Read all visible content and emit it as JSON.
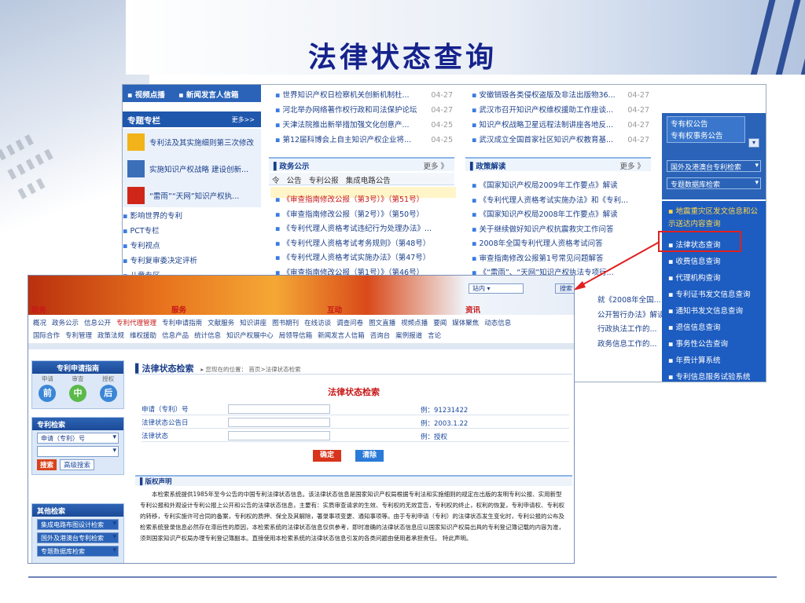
{
  "slide": {
    "title": "法律状态查询"
  },
  "back": {
    "left_tabs": [
      "视频点播",
      "新闻发言人信箱"
    ],
    "zhuanti": {
      "label": "专题专栏",
      "more": "更多>>"
    },
    "zhuanti_items": [
      "专利法及其实施细则第三次修改",
      "实施知识产权战略 建设创新...",
      "“雷雨”“天网”知识产权执..."
    ],
    "left_links": [
      "影响世界的专利",
      "PCT专栏",
      "专利视点",
      "专利复审委决定评析",
      "儿童专区"
    ],
    "news_mid": [
      {
        "t": "世界知识产权日检察机关创新机制杜...",
        "d": "04-27"
      },
      {
        "t": "河北举办网络著作权行政和司法保护论坛",
        "d": "04-27"
      },
      {
        "t": "天津法院推出新举措加强文化创意产...",
        "d": "04-25"
      },
      {
        "t": "第12届科博会上自主知识产权企业将...",
        "d": "04-25"
      }
    ],
    "news_right": [
      {
        "t": "安徽销毁各类侵权盗版及非法出版物36...",
        "d": "04-27"
      },
      {
        "t": "武汉市召开知识产权维权援助工作座谈...",
        "d": "04-27"
      },
      {
        "t": "知识产权战略卫星远程法制讲座各地反...",
        "d": "04-27"
      },
      {
        "t": "武汉成立全国首家社区知识产权教育基...",
        "d": "04-27"
      }
    ],
    "zwgs": {
      "title": "政务公示",
      "more": "更多 》",
      "tabs": [
        "令",
        "公告",
        "专利公报",
        "集成电路公告"
      ],
      "items": [
        "《审查指南修改公报（第3号）》（第51号）",
        "《审查指南修改公报（第2号）》（第50号）",
        "《专利代理人资格考试违纪行为处理办法》...",
        "《专利代理人资格考试考务规则》（第48号）",
        "《专利代理人资格考试实施办法》（第47号）",
        "《审查指南修改公报（第1号）》（第46号）"
      ]
    },
    "zcjd": {
      "title": "政策解读",
      "more": "更多 》",
      "items": [
        "《国家知识产权局2009年工作要点》解读",
        "《专利代理人资格考试实施办法》和《专利...",
        "《国家知识产权局2008年工作要点》解读",
        "关于继续做好知识产权抗震救灾工作问答",
        "2008年全国专利代理人资格考试问答",
        "审查指南修改公报第1号常见问题解答",
        "《“雷雨”、“天网”知识产权执法专项行..."
      ]
    },
    "zcjd_extra": [
      "就《2008年全国...",
      "公开暂行办法》解读",
      "行政执法工作的...",
      "政务信息工作的..."
    ],
    "dropdowns": [
      "专有权公告",
      "专有权事务公告",
      "国外及港澳台专利检索",
      "专题数据库检索"
    ],
    "quake": "地震重灾区发文信息和公示送达内容查询",
    "right_links": [
      "法律状态查询",
      "收费信息查询",
      "代理机构查询",
      "专利证书发文信息查询",
      "通知书发文信息查询",
      "退信信息查询",
      "事务性公告查询",
      "年费计算系统",
      "专利信息服务试验系统"
    ]
  },
  "front": {
    "search_box": "站内",
    "search_btn": "搜索",
    "sections": [
      "政务",
      "服务",
      "互动",
      "资讯"
    ],
    "nav1": [
      "概况",
      "政务公示",
      "信息公开",
      "专利代理管理",
      "专利申请指南",
      "文献服务",
      "知识讲座",
      "图书期刊",
      "在线访谈",
      "调查问卷",
      "图文直播",
      "视频点播",
      "要闻",
      "媒体聚焦",
      "动态信息"
    ],
    "nav2": [
      "国际合作",
      "专利管理",
      "政策法规",
      "维权援助",
      "信息产品",
      "统计信息",
      "知识产权展中心",
      "局领导信箱",
      "新闻发言人信箱",
      "咨询台",
      "案例报道",
      "言论"
    ],
    "guide": {
      "title": "专利申请指南",
      "steps": [
        "申请",
        "审查",
        "授权"
      ],
      "circles": [
        "前",
        "中",
        "后"
      ]
    },
    "zlsearch": {
      "title": "专利检索",
      "select": "申请（专利）号",
      "btn_search": "搜索",
      "btn_adv": "高级搜索"
    },
    "other": {
      "title": "其他检索",
      "selects": [
        "集成电路布图设计检索",
        "国外及港澳台专利检索",
        "专题数据库检索"
      ]
    },
    "heading": "法律状态检索",
    "crumb": "您现在的位置： 首页>法律状态检索",
    "form_title": "法律状态检索",
    "fields": [
      {
        "label": "申请（专利）号",
        "example": "例：91231422"
      },
      {
        "label": "法律状态公告日",
        "example": "例：2003.1.22"
      },
      {
        "label": "法律状态",
        "example": "例：授权"
      }
    ],
    "btn_ok": "确定",
    "btn_clear": "清除",
    "copyright_title": "版权声明",
    "copyright_text": "本检索系统提供1985年至今公告的中国专利法律状态信息。该法律状态信息是国家知识产权局根据专利法和实施细则的规定在出版的发明专利公报、实用新型专利公报和外观设计专利公报上公开和公告的法律状态信息，主要有：实质审查请求的生效、专利权的无效宣告，专利权的终止，权利的恢复，专利申请权、专利权的转移，专利实施许可合同的备案，专利权的质押、保全及其解除，著录事项变更、通知事项等。由于专利申请（专利）的法律状态发生变化时，专利公报的公布及检索系统登录信息必然存在滞后性的原因，本检索系统的法律状态信息仅供参考，即时准确的法律状态信息应以国家知识产权局出具的专利登记簿记载的内容为准，须到国家知识产权局办理专利登记簿副本。直接使用本检索系统的法律状态信息引发的各类问题由使用者承担责任。 特此声明。"
  },
  "colors": {
    "title": "#15238c",
    "highlight": "#e02020",
    "nav_blue": "#1f5bb5",
    "red_text": "#c81818"
  }
}
